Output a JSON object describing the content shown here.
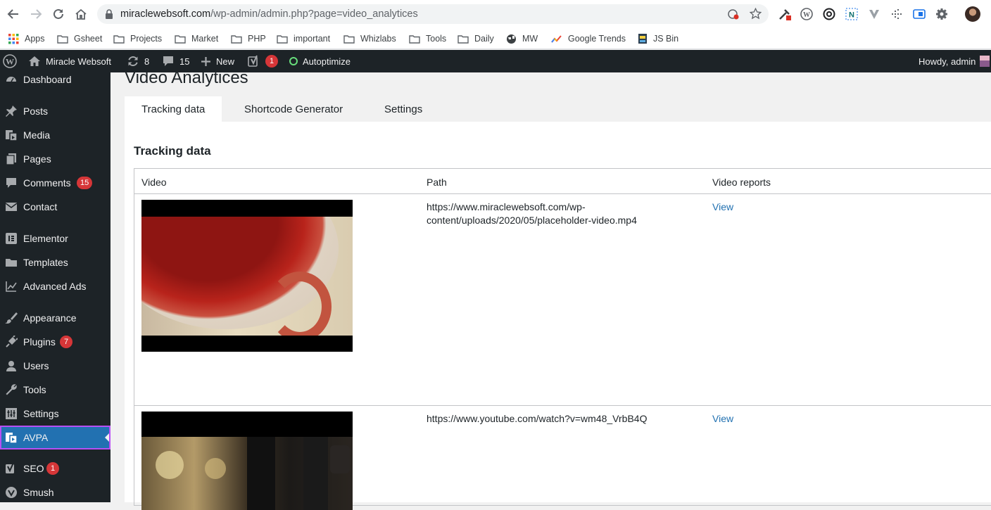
{
  "browser": {
    "url_host": "miraclewebsoft.com",
    "url_path": "/wp-admin/admin.php?page=video_analytices",
    "bookmarks": [
      "Apps",
      "Gsheet",
      "Projects",
      "Market",
      "PHP",
      "important",
      "Whizlabs",
      "Tools",
      "Daily",
      "MW",
      "Google Trends",
      "JS Bin"
    ]
  },
  "adminbar": {
    "site_name": "Miracle Websoft",
    "updates_count": "8",
    "comments_count": "15",
    "new_label": "New",
    "yoast_badge": "1",
    "autoptimize_label": "Autoptimize",
    "howdy": "Howdy, admin"
  },
  "sidebar": {
    "items": [
      {
        "label": "Dashboard",
        "icon": "dashboard-icon"
      },
      {
        "label": "Posts",
        "icon": "pin-icon"
      },
      {
        "label": "Media",
        "icon": "media-icon"
      },
      {
        "label": "Pages",
        "icon": "pages-icon"
      },
      {
        "label": "Comments",
        "icon": "comment-icon",
        "badge": "15"
      },
      {
        "label": "Contact",
        "icon": "mail-icon"
      },
      {
        "label": "Elementor",
        "icon": "elementor-icon"
      },
      {
        "label": "Templates",
        "icon": "folder-icon"
      },
      {
        "label": "Advanced Ads",
        "icon": "chart-line-icon"
      },
      {
        "label": "Appearance",
        "icon": "brush-icon"
      },
      {
        "label": "Plugins",
        "icon": "plug-icon",
        "badge": "7"
      },
      {
        "label": "Users",
        "icon": "user-icon"
      },
      {
        "label": "Tools",
        "icon": "wrench-icon"
      },
      {
        "label": "Settings",
        "icon": "settings-icon"
      },
      {
        "label": "AVPA",
        "icon": "video-analytics-icon",
        "active": true
      },
      {
        "label": "SEO",
        "icon": "yoast-icon",
        "badge": "1"
      },
      {
        "label": "Smush",
        "icon": "smush-icon"
      }
    ]
  },
  "page": {
    "title": "Video Analytices",
    "tabs": [
      "Tracking data",
      "Shortcode Generator",
      "Settings"
    ],
    "section_title": "Tracking data",
    "columns": [
      "Video",
      "Path",
      "Video reports"
    ],
    "rows": [
      {
        "path_line1": "https://www.miraclewebsoft.com/wp-",
        "path_line2": "content/uploads/2020/05/placeholder-video.mp4",
        "report": "View"
      },
      {
        "path_line1": "https://www.youtube.com/watch?v=wm48_VrbB4Q",
        "path_line2": "",
        "report": "View"
      }
    ]
  },
  "colors": {
    "wp_dark": "#1d2327",
    "wp_blue": "#2271b1",
    "badge_red": "#d63638",
    "highlight_purple": "#b84ff4"
  }
}
